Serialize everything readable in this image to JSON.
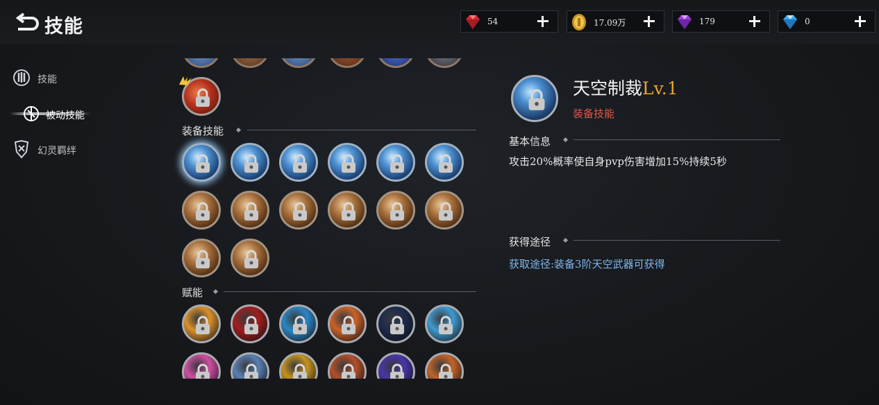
{
  "header": {
    "title": "技能",
    "back_icon": "back-arrow-icon"
  },
  "currencies": [
    {
      "name": "ruby",
      "icon": "red-gem-icon",
      "value": "54",
      "color": "#e0303a"
    },
    {
      "name": "gold",
      "icon": "gold-coin-icon",
      "value": "17.09万",
      "color": "#e4b43a"
    },
    {
      "name": "amethyst",
      "icon": "purple-gem-icon",
      "value": "179",
      "color": "#a34bdc"
    },
    {
      "name": "diamond",
      "icon": "blue-diamond-icon",
      "value": "0",
      "color": "#4fb2f0"
    }
  ],
  "sidebar": {
    "items": [
      {
        "label": "技能",
        "icon": "skill-emblem-icon",
        "active": false
      },
      {
        "label": "被动技能",
        "icon": "passive-skill-icon",
        "active": true
      },
      {
        "label": "幻灵羁绊",
        "icon": "spirit-bond-icon",
        "active": false
      }
    ]
  },
  "skill_list": {
    "sections": [
      {
        "title": "装备技能"
      },
      {
        "title": "赋能"
      }
    ],
    "equip_skill_colors": [
      "blue",
      "blue",
      "blue",
      "blue",
      "blue",
      "blue",
      "brown",
      "brown",
      "brown",
      "brown",
      "brown",
      "brown",
      "brown",
      "brown"
    ],
    "empower_colors": [
      "#d9902a",
      "#a01e1e",
      "#2d86c4",
      "#c9622a",
      "#1d2b4a",
      "#3f9ad0",
      "#cc4f9e",
      "#5a7fb0",
      "#c49320",
      "#b0502a",
      "#4a36a6",
      "#c0642a"
    ],
    "selected_index": 0
  },
  "detail": {
    "name": "天空制裁",
    "level": "Lv.1",
    "type": "装备技能",
    "basic_info_title": "基本信息",
    "basic_info_text": "攻击20%概率使自身pvp伤害增加15%持续5秒",
    "obtain_title": "获得途径",
    "obtain_text": "获取途径:装备3阶天空武器可获得"
  }
}
